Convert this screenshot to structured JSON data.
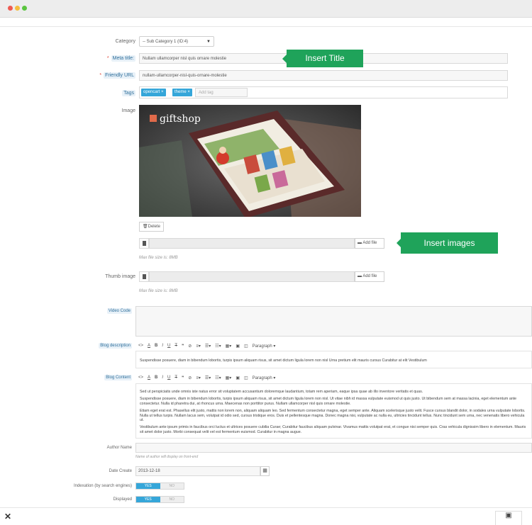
{
  "form": {
    "category": {
      "label": "Category",
      "value": "-- Sub Category 1 (ID:4)"
    },
    "meta_title": {
      "label": "Meta title:",
      "value": "Nullam ullamcorper nisl quis ornare molestie"
    },
    "friendly_url": {
      "label": "Friendly URL",
      "value": "nullam-ullamcorper-nisl-quis-ornare-molestie"
    },
    "tags": {
      "label": "Tags",
      "items": [
        "opencart",
        "theme"
      ],
      "placeholder": "Add tag"
    },
    "image": {
      "label": "Image",
      "brand": "giftshop",
      "delete_label": "Delete",
      "add_file_label": "Add file",
      "max_size_hint": "Max file size is: 8MB"
    },
    "thumb_image": {
      "label": "Thumb image",
      "add_file_label": "Add file",
      "max_size_hint": "Max file size is: 8MB"
    },
    "video_code": {
      "label": "Video Code",
      "value": ""
    },
    "blog_description": {
      "label": "Blog description",
      "toolbar_paragraph": "Paragraph",
      "text": "Suspendisse posuere, diam in bibendum lobortis, turpis ipsum aliquam risus, sit amet dictum ligula lorem non nisl Urna pretium elit mauris cursus Curabitur at elit Vestibulum"
    },
    "blog_content": {
      "label": "Blog Content",
      "toolbar_paragraph": "Paragraph",
      "paragraphs": [
        "Sed ut perspiciatis unde omnis iste natus error sit voluptatem accusantium doloremque laudantium, totam rem aperiam, eaque ipsa quae ab illo inventore veritatis et quas.",
        "Suspendisse posuere, diam in bibendum lobortis, turpis ipsum aliquam risus, sit amet dictum ligula lorem non nisl. Ut vitae nibh id massa vulputate euismod ut quis justo. Ut bibendum sem at massa lacinia, eget elementum ante consectetur. Nulla id pharetra dui, at rhoncus urna. Maecenas non porttitor purus. Nullam ullamcorper nisl quis ornare molestie.",
        "Etiam eget erat est. Phasellus elit justo, mattis non lorem non, aliquam aliquam leo. Sed fermentum consectetur magna, eget semper ante. Aliquam scelerisque justo velit. Fusce cursus blandit dolor, in sodales urna vulputate lobortis. Nulla ut tellus turpis. Nullam lacus sem, volutpat id odio sed, cursus tristique eros. Duis et pellentesque magna. Donec magna nisi, vulputate ac nulla eu, ultricies tincidunt tellus. Nunc tincidunt sem urna, nec venenatis libero vehicula ut.",
        "Vestibulum ante ipsum primis in faucibus orci luctus et ultrices posuere cubilia Curae; Curabitur faucibus aliquam pulvinar. Vivamus mattis volutpat erat, et congue nisi semper quis. Cras vehicula dignissim libero in elementum. Mauris sit amet dolor justo. Morbi consequat velit vel est fermentum euismod. Curabitur in magna augue."
      ]
    },
    "author_name": {
      "label": "Author Name",
      "value": "",
      "hint": "Name of author will display on front-end"
    },
    "date_create": {
      "label": "Date Create",
      "value": "2013-12-18"
    },
    "indexation": {
      "label": "Indexation (by search engines)",
      "yes": "YES",
      "no": "NO"
    },
    "displayed": {
      "label": "Displayed",
      "yes": "YES",
      "no": "NO"
    }
  },
  "callouts": {
    "title": "Insert Title",
    "images": "Insert images"
  },
  "colors": {
    "accent": "#35a6d9",
    "callout": "#1fa35a",
    "required": "#e04a3c"
  }
}
